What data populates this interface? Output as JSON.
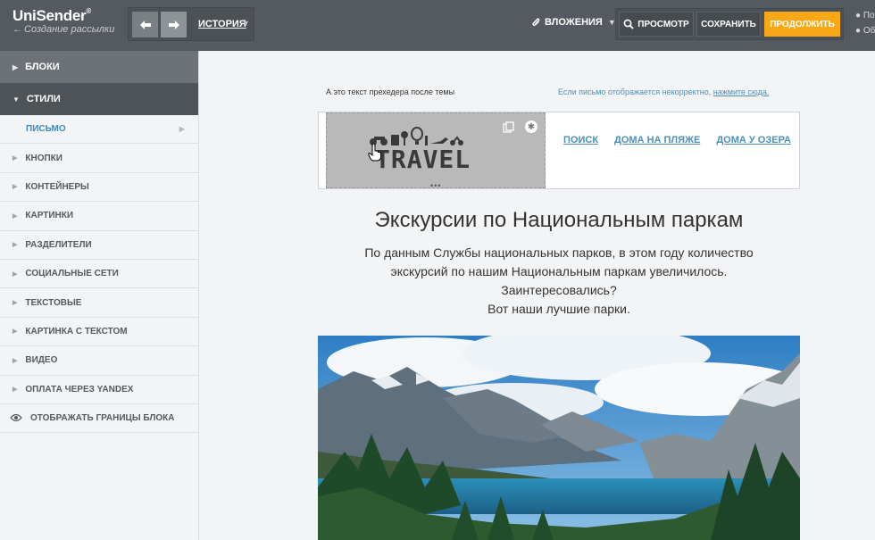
{
  "app": {
    "logo_text": "UniSender",
    "logo_mark": "®",
    "back_label": "Создание рассылки"
  },
  "toolbar": {
    "history_label": "ИСТОРИЯ",
    "attachments_label": "ВЛОЖЕНИЯ",
    "preview_label": "ПРОСМОТР",
    "save_label": "СОХРАНИТЬ",
    "continue_label": "ПРОДОЛЖИТЬ",
    "cut_text_1": "По",
    "cut_text_2": "Об"
  },
  "sidebar": {
    "blocks_label": "БЛОКИ",
    "styles_label": "СТИЛИ",
    "items": [
      {
        "label": "ПИСЬМО",
        "active": true
      },
      {
        "label": "КНОПКИ"
      },
      {
        "label": "КОНТЕЙНЕРЫ"
      },
      {
        "label": "КАРТИНКИ"
      },
      {
        "label": "РАЗДЕЛИТЕЛИ"
      },
      {
        "label": "СОЦИАЛЬНЫЕ СЕТИ"
      },
      {
        "label": "ТЕКСТОВЫЕ"
      },
      {
        "label": "КАРТИНКА С ТЕКСТОМ"
      },
      {
        "label": "ВИДЕО"
      },
      {
        "label": "ОПЛАТА ЧЕРЕЗ YANDEX"
      }
    ],
    "toggle_borders_label": "ОТОБРАЖАТЬ ГРАНИЦЫ БЛОКА"
  },
  "email": {
    "preheader": "А это текст прехедера после темы",
    "webview_text": "Если письмо отображается некорректно,",
    "webview_link": "нажмите сюда.",
    "logo_word": "TRAVEL",
    "nav": [
      "ПОИСК",
      "ДОМА НА ПЛЯЖЕ",
      "ДОМА У ОЗЕРА"
    ],
    "headline": "Экскурсии по Национальным паркам",
    "body_lines": [
      "По данным Службы национальных парков, в этом году количество",
      "экскурсий по нашим Национальным паркам увеличилось.",
      "Заинтересовались?",
      "Вот наши лучшие парки."
    ]
  },
  "colors": {
    "topbar": "#555a60",
    "accent_orange": "#f7a814",
    "link_blue": "#4d8fb8"
  }
}
